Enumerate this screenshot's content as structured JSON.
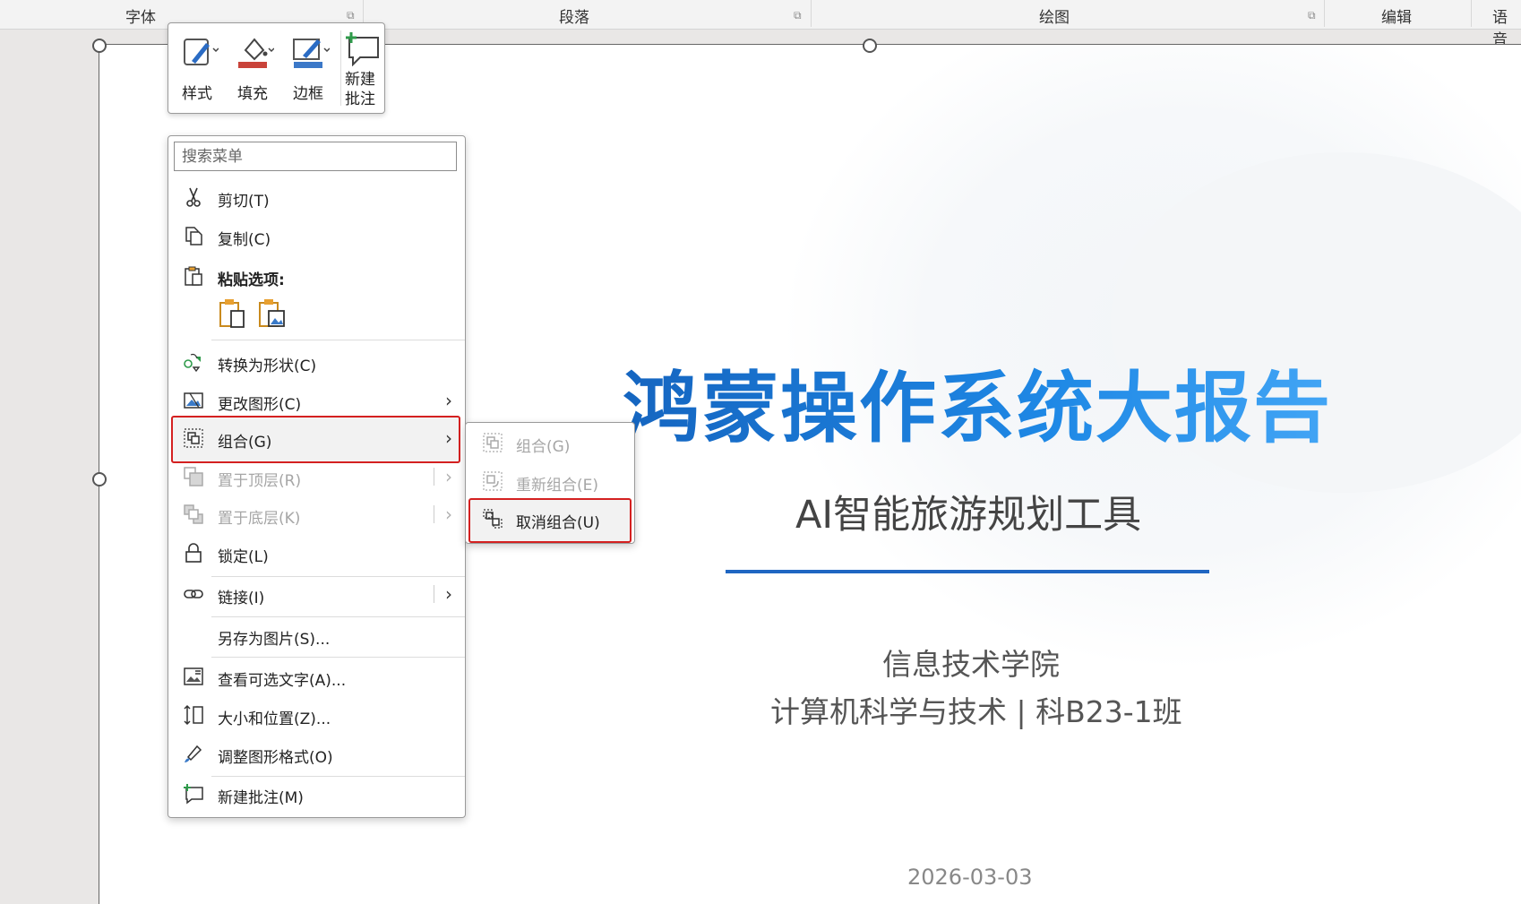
{
  "ribbon": {
    "groups": [
      {
        "label": "字体"
      },
      {
        "label": "段落"
      },
      {
        "label": "绘图"
      },
      {
        "label": "编辑"
      },
      {
        "label": "语音"
      }
    ]
  },
  "mini_toolbar": {
    "buttons": [
      {
        "label": "样式",
        "icon": "style-icon"
      },
      {
        "label": "填充",
        "icon": "fill-bucket-icon"
      },
      {
        "label": "边框",
        "icon": "border-pen-icon"
      },
      {
        "label_line1": "新建",
        "label_line2": "批注",
        "icon": "new-comment-icon"
      }
    ]
  },
  "context_menu": {
    "search_placeholder": "搜索菜单",
    "items": {
      "cut": "剪切(T)",
      "copy": "复制(C)",
      "paste_options": "粘贴选项:",
      "convert_shape": "转换为形状(C)",
      "change_graphic": "更改图形(C)",
      "group": "组合(G)",
      "bring_to_front": "置于顶层(R)",
      "send_to_back": "置于底层(K)",
      "lock": "锁定(L)",
      "link": "链接(I)",
      "save_as_picture": "另存为图片(S)...",
      "alt_text": "查看可选文字(A)...",
      "size_position": "大小和位置(Z)...",
      "format_graphic": "调整图形格式(O)",
      "new_comment": "新建批注(M)"
    }
  },
  "submenu": {
    "group": "组合(G)",
    "regroup": "重新组合(E)",
    "ungroup": "取消组合(U)"
  },
  "slide": {
    "title": "鸿蒙操作系统大报告",
    "subtitle": "AI智能旅游规划工具",
    "org_line1": "信息技术学院",
    "org_line2": "计算机科学与技术 | 科B23-1班",
    "date": "2026-03-03"
  },
  "colors": {
    "title_blue": "#1e7ad6",
    "divider_blue": "#1f66c2",
    "highlight_red": "#d42020"
  }
}
